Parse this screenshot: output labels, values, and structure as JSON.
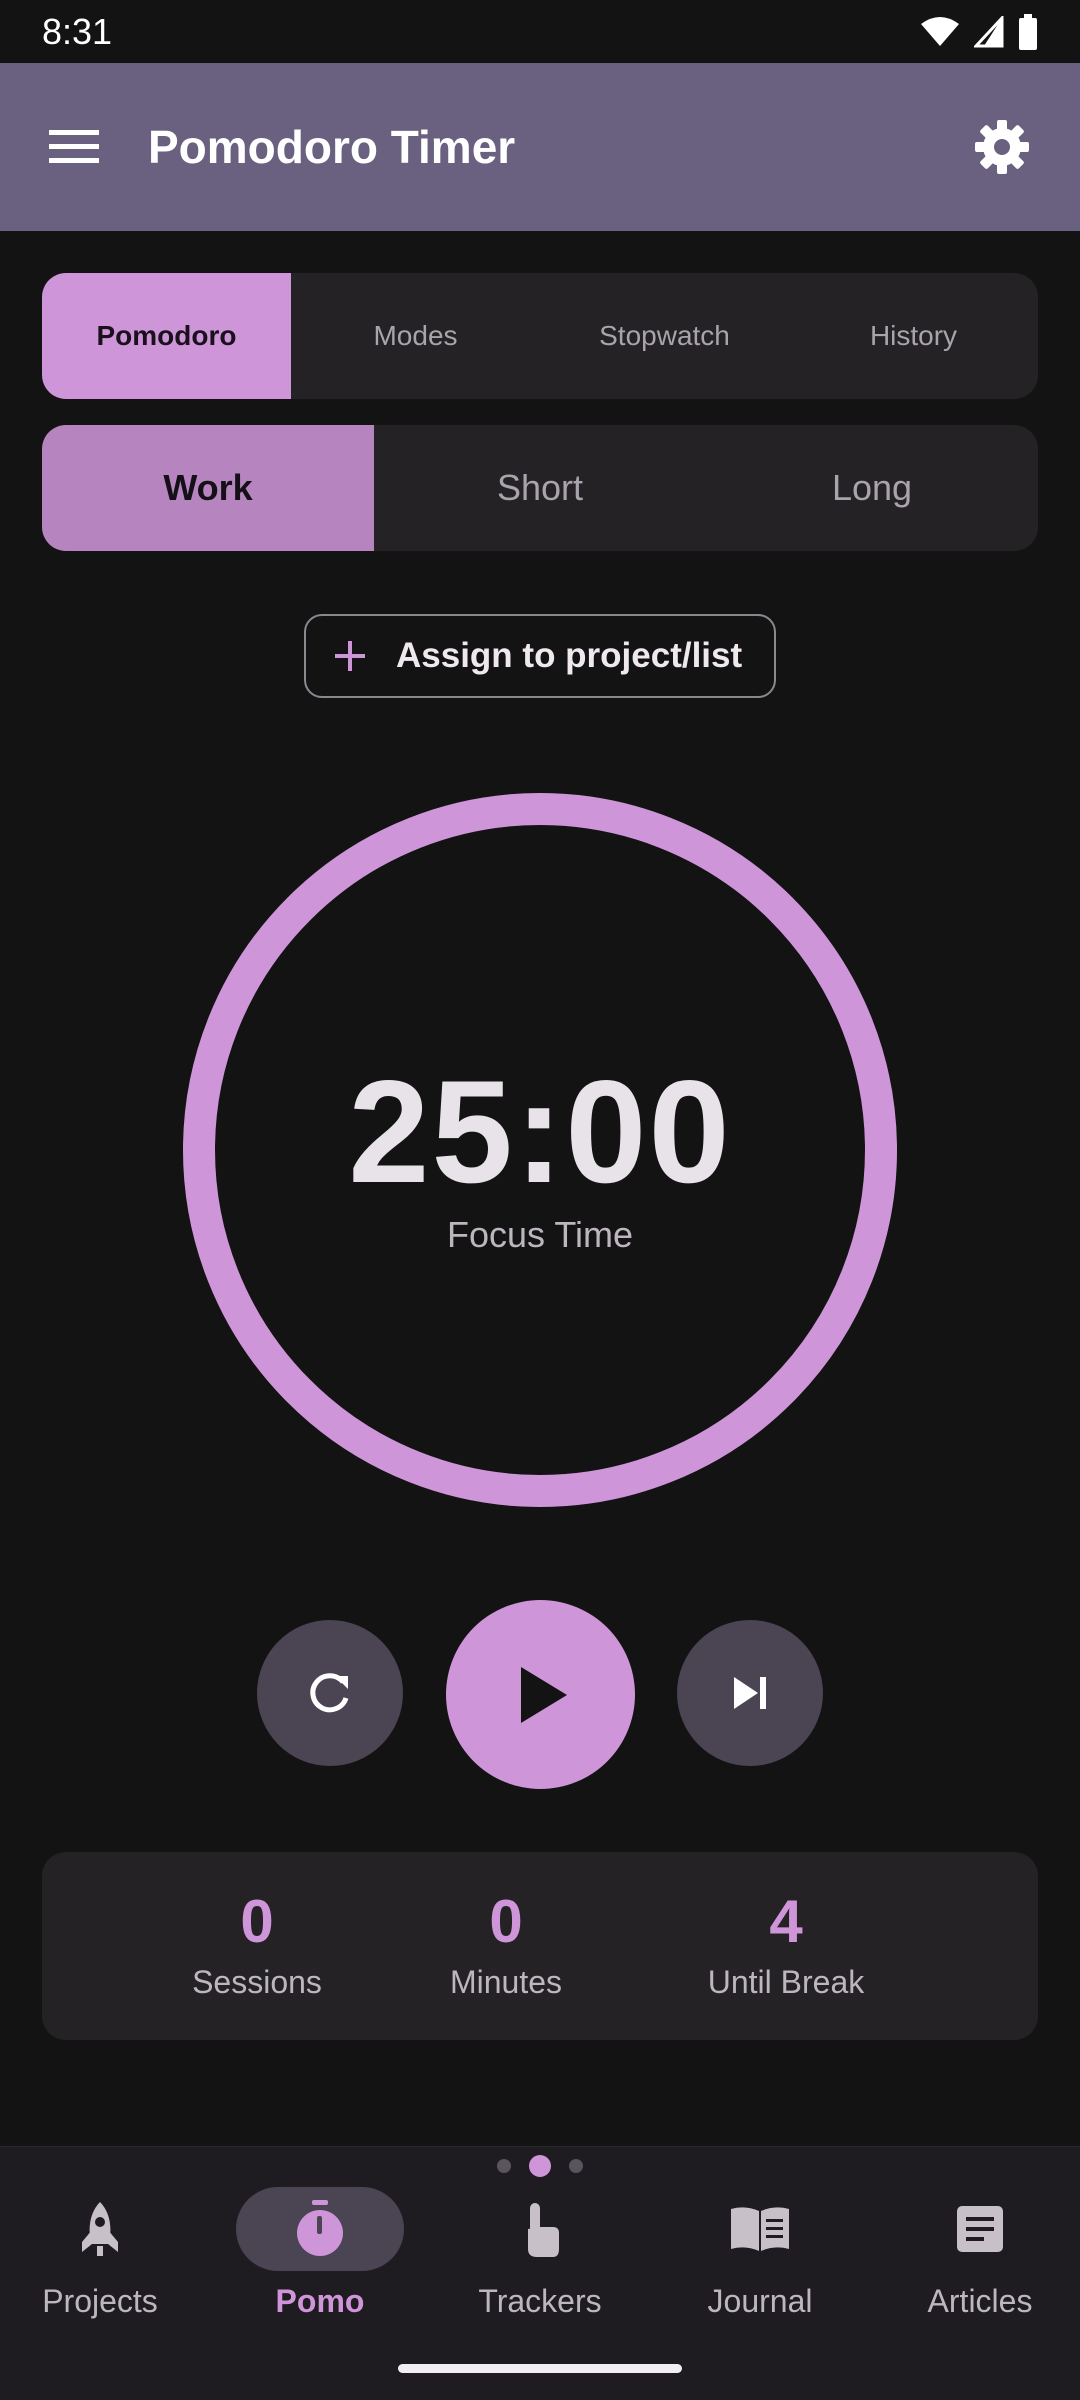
{
  "status_bar": {
    "time": "8:31"
  },
  "app_bar": {
    "title": "Pomodoro Timer"
  },
  "mode_tabs": [
    {
      "label": "Pomodoro",
      "active": true
    },
    {
      "label": "Modes",
      "active": false
    },
    {
      "label": "Stopwatch",
      "active": false
    },
    {
      "label": "History",
      "active": false
    }
  ],
  "session_tabs": [
    {
      "label": "Work",
      "active": true
    },
    {
      "label": "Short",
      "active": false
    },
    {
      "label": "Long",
      "active": false
    }
  ],
  "assign_button": {
    "label": "Assign to project/list"
  },
  "timer": {
    "time": "25:00",
    "label": "Focus Time",
    "progress": 1.0
  },
  "stats": [
    {
      "value": "0",
      "label": "Sessions"
    },
    {
      "value": "0",
      "label": "Minutes"
    },
    {
      "value": "4",
      "label": "Until Break"
    }
  ],
  "page_indicator": {
    "count": 3,
    "active_index": 1
  },
  "bottom_nav": [
    {
      "label": "Projects",
      "icon": "rocket-icon",
      "active": false
    },
    {
      "label": "Pomo",
      "icon": "timer-icon",
      "active": true
    },
    {
      "label": "Trackers",
      "icon": "touch-icon",
      "active": false
    },
    {
      "label": "Journal",
      "icon": "book-icon",
      "active": false
    },
    {
      "label": "Articles",
      "icon": "article-icon",
      "active": false
    }
  ],
  "colors": {
    "accent": "#cf95d9",
    "app_bar": "#6a6181",
    "background": "#141314",
    "surface": "#242225",
    "control_button": "#4a4453"
  }
}
